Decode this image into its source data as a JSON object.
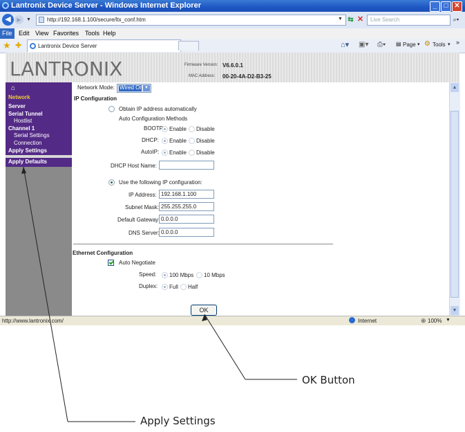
{
  "window": {
    "title": "Lantronix Device Server - Windows Internet Explorer"
  },
  "browser": {
    "url": "http://192.168.1.100/secure/ltx_conf.htm",
    "search_placeholder": "Live Search",
    "menu": [
      "File",
      "Edit",
      "View",
      "Favorites",
      "Tools",
      "Help"
    ],
    "tab_label": "Lantronix Device Server",
    "cmd_page": "Page",
    "cmd_tools": "Tools"
  },
  "header": {
    "logo": "LANTRONIX",
    "firmware_label": "Firmware Version:",
    "firmware_value": "V6.6.0.1",
    "mac_label": "MAC Address:",
    "mac_value": "00-20-4A-D2-B3-25"
  },
  "sidebar": {
    "items": [
      {
        "label": "Network"
      },
      {
        "label": "Server"
      },
      {
        "label": "Serial Tunnel"
      },
      {
        "label": "Hostlist"
      },
      {
        "label": "Channel 1"
      },
      {
        "label": "Serial Settings"
      },
      {
        "label": "Connection"
      },
      {
        "label": "Apply Settings"
      },
      {
        "label": "Apply Defaults"
      }
    ]
  },
  "form": {
    "network_mode_label": "Network Mode:",
    "network_mode_value": "Wired Only",
    "ip_config_heading": "IP Configuration",
    "obtain_auto": "Obtain IP address automatically",
    "auto_methods": "Auto Configuration Methods",
    "bootp_label": "BOOTP:",
    "dhcp_label": "DHCP:",
    "autoip_label": "AutoIP:",
    "enable": "Enable",
    "disable": "Disable",
    "dhcp_host_label": "DHCP Host Name:",
    "dhcp_host_value": "",
    "use_following": "Use the following IP configuration:",
    "ip_label": "IP Address:",
    "ip_value": "192.168.1.100",
    "subnet_label": "Subnet Mask:",
    "subnet_value": "255.255.255.0",
    "gateway_label": "Default Gateway:",
    "gateway_value": "0.0.0.0",
    "dns_label": "DNS Server:",
    "dns_value": "0.0.0.0",
    "ethernet_heading": "Ethernet Configuration",
    "auto_negotiate": "Auto Negotiate",
    "speed_label": "Speed:",
    "speed_100": "100 Mbps",
    "speed_10": "10 Mbps",
    "duplex_label": "Duplex:",
    "duplex_full": "Full",
    "duplex_half": "Half",
    "ok_label": "OK"
  },
  "statusbar": {
    "url": "http://www.lantronix.com/",
    "zone": "Internet",
    "zoom": "100%"
  },
  "annotations": {
    "ok_button": "OK Button",
    "apply_settings": "Apply Settings"
  }
}
